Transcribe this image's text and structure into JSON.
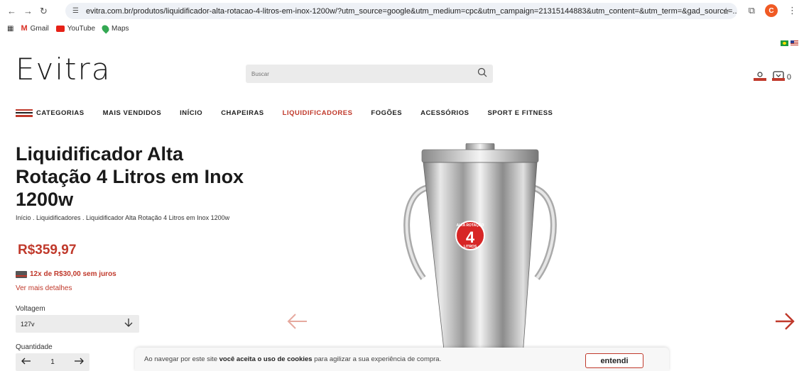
{
  "browser": {
    "url": "evitra.com.br/produtos/liquidificador-alta-rotacao-4-litros-em-inox-1200w/?utm_source=google&utm_medium=cpc&utm_campaign=21315144883&utm_content=&utm_term=&gad_source=...",
    "profile_initial": "C",
    "bookmarks": [
      "Gmail",
      "YouTube",
      "Maps"
    ]
  },
  "header": {
    "logo": "Evitra",
    "search_placeholder": "Buscar",
    "cart_count": "0"
  },
  "menu": {
    "items": [
      "CATEGORIAS",
      "MAIS VENDIDOS",
      "INÍCIO",
      "CHAPEIRAS",
      "LIQUIDIFICADORES",
      "FOGÕES",
      "ACESSÓRIOS",
      "SPORT E FITNESS"
    ],
    "active": "LIQUIDIFICADORES"
  },
  "product": {
    "title": "Liquidificador Alta Rotação 4 Litros em Inox 1200w",
    "breadcrumb": "Início .  Liquidificadores .  Liquidificador Alta Rotação 4 Litros em Inox 1200w",
    "price": "R$359,97",
    "installments": "12x de R$30,00 sem juros",
    "more_details": "Ver mais detalhes",
    "voltage_label": "Voltagem",
    "voltage_value": "127v",
    "quantity_label": "Quantidade",
    "quantity_value": "1",
    "badge_top": "ALTA ROTAÇÃO",
    "badge_number": "4",
    "badge_bottom": "LITROS"
  },
  "cookie": {
    "text_before": "Ao navegar por este site ",
    "text_bold": "você aceita o uso de cookies",
    "text_after": " para agilizar a sua experiência de compra.",
    "button": "entendi"
  },
  "colors": {
    "accent": "#c0392b",
    "input_bg": "#ececec"
  }
}
